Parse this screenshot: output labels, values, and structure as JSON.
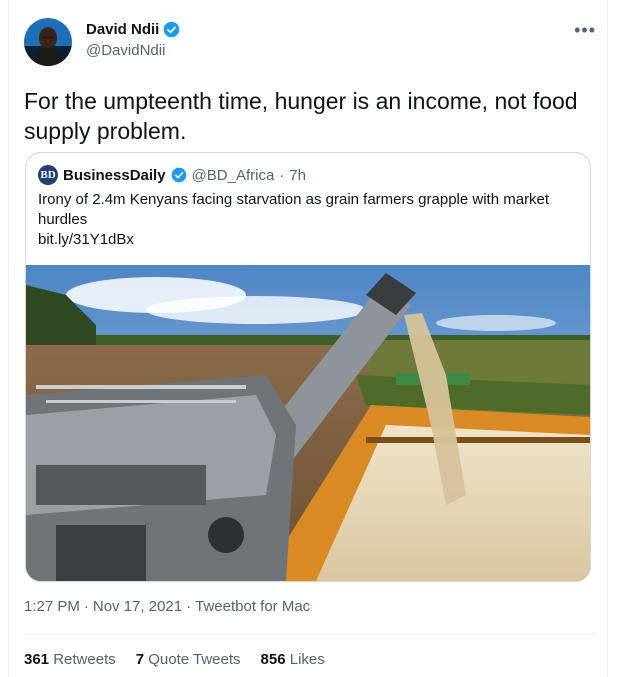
{
  "author": {
    "name": "David Ndii",
    "handle": "@DavidNdii"
  },
  "tweet_text": "For the umpteenth time, hunger is an income, not food supply problem.",
  "quote": {
    "logo_text": "BD",
    "name": "BusinessDaily",
    "handle": "@BD_Africa",
    "separator": "·",
    "time": "7h",
    "text": "Irony of 2.4m Kenyans facing starvation as grain farmers grapple with market hurdles",
    "link": "bit.ly/31Y1dBx"
  },
  "meta": {
    "time": "1:27 PM",
    "sep1": "·",
    "date": "Nov 17, 2021",
    "sep2": "·",
    "client": "Tweetbot for Mac"
  },
  "stats": {
    "retweets_count": "361",
    "retweets_label": "Retweets",
    "quotes_count": "7",
    "quotes_label": "Quote Tweets",
    "likes_count": "856",
    "likes_label": "Likes"
  },
  "colors": {
    "verified": "#1d9bf0",
    "secondary_text": "#536471",
    "border": "#cfd9de"
  },
  "icons": {
    "more": "more-options-icon",
    "verified": "verified-badge-icon"
  }
}
